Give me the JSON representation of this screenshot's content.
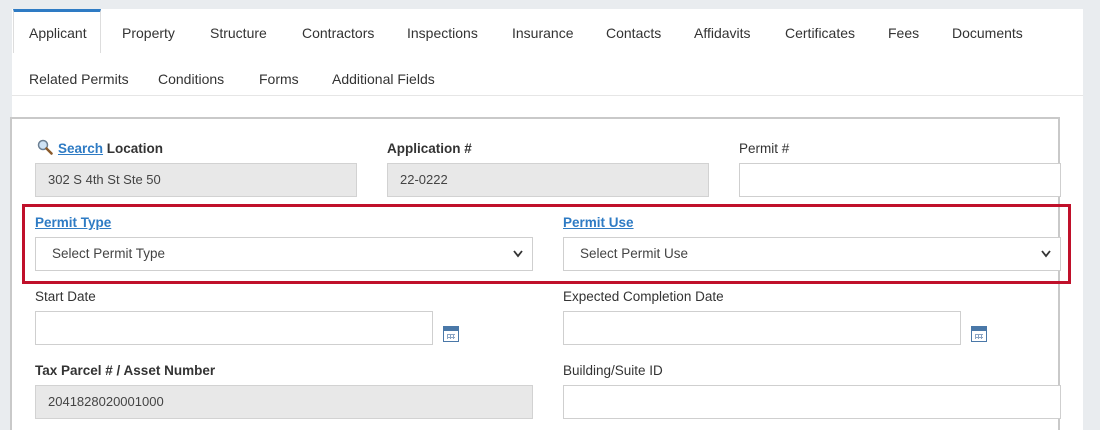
{
  "tabs": {
    "row1": [
      "Applicant",
      "Property",
      "Structure",
      "Contractors",
      "Inspections",
      "Insurance",
      "Contacts",
      "Affidavits",
      "Certificates",
      "Fees",
      "Documents"
    ],
    "row2": [
      "Related Permits",
      "Conditions",
      "Forms",
      "Additional Fields"
    ],
    "active": "Applicant"
  },
  "form": {
    "location": {
      "search_link": "Search",
      "label": "Location",
      "value": "302 S 4th St Ste 50"
    },
    "application": {
      "label": "Application #",
      "value": "22-0222"
    },
    "permit_number": {
      "label": "Permit #",
      "value": ""
    },
    "permit_type": {
      "label": "Permit Type",
      "selected": "Select Permit Type"
    },
    "permit_use": {
      "label": "Permit Use",
      "selected": "Select Permit Use"
    },
    "start_date": {
      "label": "Start Date",
      "value": ""
    },
    "expected_completion": {
      "label": "Expected Completion Date",
      "value": ""
    },
    "tax_parcel": {
      "label": "Tax Parcel # / Asset Number",
      "value": "2041828020001000"
    },
    "building_suite": {
      "label": "Building/Suite ID",
      "value": ""
    }
  },
  "colors": {
    "accent": "#2e7bc4",
    "highlight": "#c0102a"
  }
}
